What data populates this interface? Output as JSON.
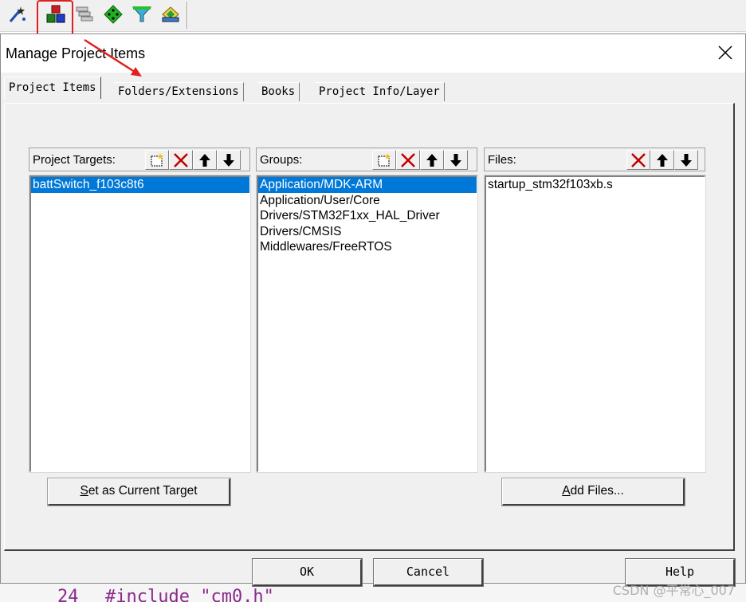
{
  "toolbar": {
    "icons": [
      "magic-wand-icon",
      "manage-project-items-icon",
      "stacked-windows-icon",
      "green-diamond-icon",
      "funnel-icon",
      "pack-installer-icon"
    ]
  },
  "dialog": {
    "title": "Manage Project Items",
    "tabs": [
      {
        "label": "Project Items",
        "active": true
      },
      {
        "label": "Folders/Extensions",
        "active": false
      },
      {
        "label": "Books",
        "active": false
      },
      {
        "label": "Project Info/Layer",
        "active": false
      }
    ],
    "targets": {
      "label": "Project Targets:",
      "items": [
        {
          "text": "battSwitch_f103c8t6",
          "selected": true
        }
      ]
    },
    "groups": {
      "label": "Groups:",
      "items": [
        {
          "text": "Application/MDK-ARM",
          "selected": true
        },
        {
          "text": "Application/User/Core",
          "selected": false
        },
        {
          "text": "Drivers/STM32F1xx_HAL_Driver",
          "selected": false
        },
        {
          "text": "Drivers/CMSIS",
          "selected": false
        },
        {
          "text": "Middlewares/FreeRTOS",
          "selected": false
        }
      ]
    },
    "files": {
      "label": "Files:",
      "items": [
        {
          "text": "startup_stm32f103xb.s",
          "selected": false
        }
      ]
    },
    "set_target_prefix": "S",
    "set_target_rest": "et as Current Target",
    "add_files_prefix": "A",
    "add_files_rest": "dd Files...",
    "ok_label": "OK",
    "cancel_label": "Cancel",
    "help_label": "Help"
  },
  "editor": {
    "line_number": "24",
    "code": "#include  \"cm0.h\""
  },
  "watermark": "CSDN @平常心_007",
  "colors": {
    "selection": "#0078d7",
    "highlight_red": "#e02020",
    "dialog_face": "#f0f0f0"
  }
}
